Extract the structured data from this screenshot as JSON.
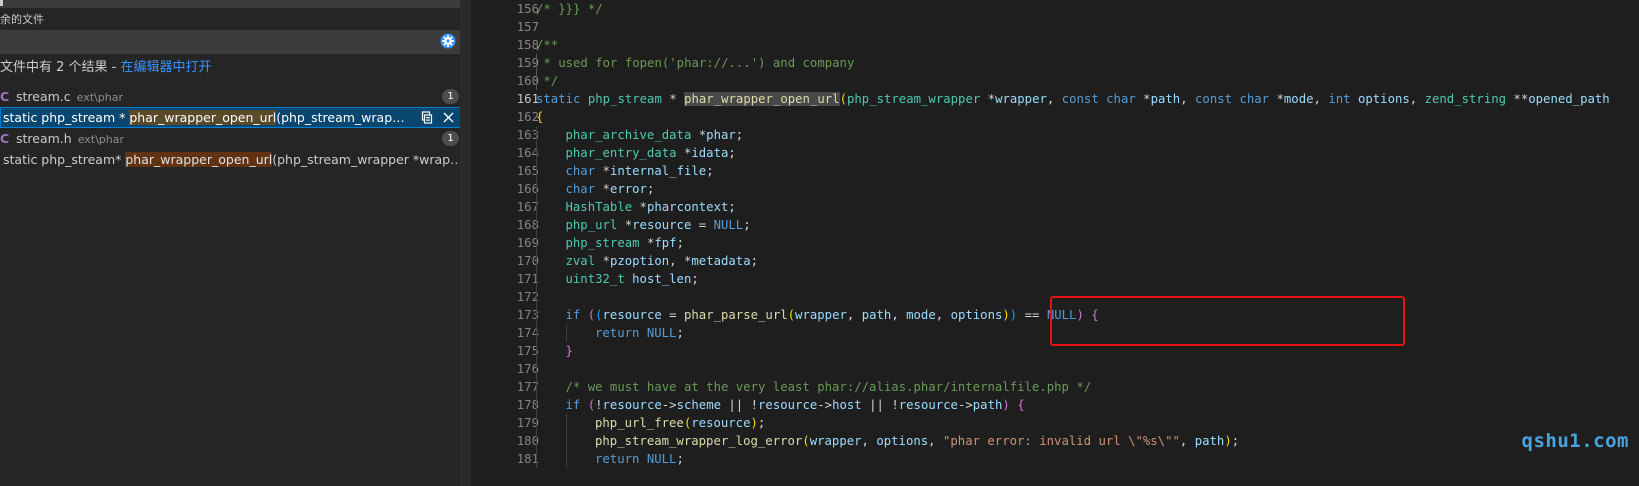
{
  "search_panel": {
    "files_label": "余的文件",
    "summary_text": "文件中有 2 个结果 - ",
    "open_in_editor_link": "在编辑器中打开",
    "results": [
      {
        "file": "stream.c",
        "dir": "ext\\phar",
        "count": "1",
        "match": {
          "before": "static php_stream * ",
          "highlight": "phar_wrapper_open_url",
          "after": "(php_stream_wrapper *wrapp..."
        }
      },
      {
        "file": "stream.h",
        "dir": "ext\\phar",
        "count": "1",
        "match": {
          "before": "static php_stream* ",
          "highlight": "phar_wrapper_open_url",
          "after": "(php_stream_wrapper *wrapper, const ch..."
        }
      }
    ]
  },
  "editor": {
    "current_line": "161",
    "lines": [
      {
        "n": "156",
        "indent": 0,
        "tokens": [
          {
            "c": "cm",
            "t": "/* }}} */"
          }
        ]
      },
      {
        "n": "157",
        "indent": 0,
        "tokens": []
      },
      {
        "n": "158",
        "indent": 0,
        "tokens": [
          {
            "c": "cm",
            "t": "/**"
          }
        ]
      },
      {
        "n": "159",
        "indent": 0,
        "tokens": [
          {
            "c": "cm",
            "t": " * used for fopen('phar://...') and company"
          }
        ]
      },
      {
        "n": "160",
        "indent": 0,
        "tokens": [
          {
            "c": "cm",
            "t": " */"
          }
        ]
      },
      {
        "n": "161",
        "indent": 0,
        "tokens": [
          {
            "c": "kw",
            "t": "static"
          },
          {
            "c": "pl",
            "t": " "
          },
          {
            "c": "ty",
            "t": "php_stream"
          },
          {
            "c": "pl",
            "t": " * "
          },
          {
            "c": "fn hlsym",
            "t": "phar_wrapper_open_url"
          },
          {
            "c": "br1",
            "t": "("
          },
          {
            "c": "ty",
            "t": "php_stream_wrapper"
          },
          {
            "c": "pl",
            "t": " *"
          },
          {
            "c": "va",
            "t": "wrapper"
          },
          {
            "c": "pl",
            "t": ", "
          },
          {
            "c": "kw",
            "t": "const"
          },
          {
            "c": "pl",
            "t": " "
          },
          {
            "c": "kw",
            "t": "char"
          },
          {
            "c": "pl",
            "t": " *"
          },
          {
            "c": "va",
            "t": "path"
          },
          {
            "c": "pl",
            "t": ", "
          },
          {
            "c": "kw",
            "t": "const"
          },
          {
            "c": "pl",
            "t": " "
          },
          {
            "c": "kw",
            "t": "char"
          },
          {
            "c": "pl",
            "t": " *"
          },
          {
            "c": "va",
            "t": "mode"
          },
          {
            "c": "pl",
            "t": ", "
          },
          {
            "c": "kw",
            "t": "int"
          },
          {
            "c": "pl",
            "t": " "
          },
          {
            "c": "va",
            "t": "options"
          },
          {
            "c": "pl",
            "t": ", "
          },
          {
            "c": "ty",
            "t": "zend_string"
          },
          {
            "c": "pl",
            "t": " **"
          },
          {
            "c": "va",
            "t": "opened_path"
          }
        ]
      },
      {
        "n": "162",
        "indent": 0,
        "tokens": [
          {
            "c": "br1",
            "t": "{"
          }
        ]
      },
      {
        "n": "163",
        "indent": 1,
        "tokens": [
          {
            "c": "ty",
            "t": "phar_archive_data"
          },
          {
            "c": "pl",
            "t": " *"
          },
          {
            "c": "va",
            "t": "phar"
          },
          {
            "c": "pl",
            "t": ";"
          }
        ]
      },
      {
        "n": "164",
        "indent": 1,
        "tokens": [
          {
            "c": "ty",
            "t": "phar_entry_data"
          },
          {
            "c": "pl",
            "t": " *"
          },
          {
            "c": "va",
            "t": "idata"
          },
          {
            "c": "pl",
            "t": ";"
          }
        ]
      },
      {
        "n": "165",
        "indent": 1,
        "tokens": [
          {
            "c": "kw",
            "t": "char"
          },
          {
            "c": "pl",
            "t": " *"
          },
          {
            "c": "va",
            "t": "internal_file"
          },
          {
            "c": "pl",
            "t": ";"
          }
        ]
      },
      {
        "n": "166",
        "indent": 1,
        "tokens": [
          {
            "c": "kw",
            "t": "char"
          },
          {
            "c": "pl",
            "t": " *"
          },
          {
            "c": "va",
            "t": "error"
          },
          {
            "c": "pl",
            "t": ";"
          }
        ]
      },
      {
        "n": "167",
        "indent": 1,
        "tokens": [
          {
            "c": "ty",
            "t": "HashTable"
          },
          {
            "c": "pl",
            "t": " *"
          },
          {
            "c": "va",
            "t": "pharcontext"
          },
          {
            "c": "pl",
            "t": ";"
          }
        ]
      },
      {
        "n": "168",
        "indent": 1,
        "tokens": [
          {
            "c": "ty",
            "t": "php_url"
          },
          {
            "c": "pl",
            "t": " *"
          },
          {
            "c": "va",
            "t": "resource"
          },
          {
            "c": "pl",
            "t": " = "
          },
          {
            "c": "kw",
            "t": "NULL"
          },
          {
            "c": "pl",
            "t": ";"
          }
        ]
      },
      {
        "n": "169",
        "indent": 1,
        "tokens": [
          {
            "c": "ty",
            "t": "php_stream"
          },
          {
            "c": "pl",
            "t": " *"
          },
          {
            "c": "va",
            "t": "fpf"
          },
          {
            "c": "pl",
            "t": ";"
          }
        ]
      },
      {
        "n": "170",
        "indent": 1,
        "tokens": [
          {
            "c": "ty",
            "t": "zval"
          },
          {
            "c": "pl",
            "t": " *"
          },
          {
            "c": "va",
            "t": "pzoption"
          },
          {
            "c": "pl",
            "t": ", *"
          },
          {
            "c": "va",
            "t": "metadata"
          },
          {
            "c": "pl",
            "t": ";"
          }
        ]
      },
      {
        "n": "171",
        "indent": 1,
        "tokens": [
          {
            "c": "ty",
            "t": "uint32_t"
          },
          {
            "c": "pl",
            "t": " "
          },
          {
            "c": "va",
            "t": "host_len"
          },
          {
            "c": "pl",
            "t": ";"
          }
        ]
      },
      {
        "n": "172",
        "indent": 1,
        "tokens": []
      },
      {
        "n": "173",
        "indent": 1,
        "tokens": [
          {
            "c": "kw",
            "t": "if"
          },
          {
            "c": "pl",
            "t": " "
          },
          {
            "c": "br2",
            "t": "("
          },
          {
            "c": "br3",
            "t": "("
          },
          {
            "c": "va",
            "t": "resource"
          },
          {
            "c": "pl",
            "t": " = "
          },
          {
            "c": "fn",
            "t": "phar_parse_url"
          },
          {
            "c": "br1",
            "t": "("
          },
          {
            "c": "va",
            "t": "wrapper"
          },
          {
            "c": "pl",
            "t": ", "
          },
          {
            "c": "va",
            "t": "path"
          },
          {
            "c": "pl",
            "t": ", "
          },
          {
            "c": "va",
            "t": "mode"
          },
          {
            "c": "pl",
            "t": ", "
          },
          {
            "c": "va",
            "t": "options"
          },
          {
            "c": "br1",
            "t": ")"
          },
          {
            "c": "br3",
            "t": ")"
          },
          {
            "c": "pl",
            "t": " == "
          },
          {
            "c": "kw",
            "t": "NULL"
          },
          {
            "c": "br2",
            "t": ")"
          },
          {
            "c": "pl",
            "t": " "
          },
          {
            "c": "br2",
            "t": "{"
          }
        ]
      },
      {
        "n": "174",
        "indent": 2,
        "tokens": [
          {
            "c": "kw",
            "t": "return"
          },
          {
            "c": "pl",
            "t": " "
          },
          {
            "c": "kw",
            "t": "NULL"
          },
          {
            "c": "pl",
            "t": ";"
          }
        ]
      },
      {
        "n": "175",
        "indent": 1,
        "tokens": [
          {
            "c": "br2",
            "t": "}"
          }
        ]
      },
      {
        "n": "176",
        "indent": 1,
        "tokens": []
      },
      {
        "n": "177",
        "indent": 1,
        "tokens": [
          {
            "c": "cm",
            "t": "/* we must have at the very least phar://alias.phar/internalfile.php */"
          }
        ]
      },
      {
        "n": "178",
        "indent": 1,
        "tokens": [
          {
            "c": "kw",
            "t": "if"
          },
          {
            "c": "pl",
            "t": " "
          },
          {
            "c": "br2",
            "t": "("
          },
          {
            "c": "pl",
            "t": "!"
          },
          {
            "c": "va",
            "t": "resource"
          },
          {
            "c": "pl",
            "t": "->"
          },
          {
            "c": "va",
            "t": "scheme"
          },
          {
            "c": "pl",
            "t": " || !"
          },
          {
            "c": "va",
            "t": "resource"
          },
          {
            "c": "pl",
            "t": "->"
          },
          {
            "c": "va",
            "t": "host"
          },
          {
            "c": "pl",
            "t": " || !"
          },
          {
            "c": "va",
            "t": "resource"
          },
          {
            "c": "pl",
            "t": "->"
          },
          {
            "c": "va",
            "t": "path"
          },
          {
            "c": "br2",
            "t": ")"
          },
          {
            "c": "pl",
            "t": " "
          },
          {
            "c": "br2",
            "t": "{"
          }
        ]
      },
      {
        "n": "179",
        "indent": 2,
        "tokens": [
          {
            "c": "fn",
            "t": "php_url_free"
          },
          {
            "c": "br1",
            "t": "("
          },
          {
            "c": "va",
            "t": "resource"
          },
          {
            "c": "br1",
            "t": ")"
          },
          {
            "c": "pl",
            "t": ";"
          }
        ]
      },
      {
        "n": "180",
        "indent": 2,
        "tokens": [
          {
            "c": "fn",
            "t": "php_stream_wrapper_log_error"
          },
          {
            "c": "br1",
            "t": "("
          },
          {
            "c": "va",
            "t": "wrapper"
          },
          {
            "c": "pl",
            "t": ", "
          },
          {
            "c": "va",
            "t": "options"
          },
          {
            "c": "pl",
            "t": ", "
          },
          {
            "c": "st",
            "t": "\"phar error: invalid url \\\"%s\\\"\""
          },
          {
            "c": "pl",
            "t": ", "
          },
          {
            "c": "va",
            "t": "path"
          },
          {
            "c": "br1",
            "t": ")"
          },
          {
            "c": "pl",
            "t": ";"
          }
        ]
      },
      {
        "n": "181",
        "indent": 2,
        "tokens": [
          {
            "c": "kw",
            "t": "return"
          },
          {
            "c": "pl",
            "t": " "
          },
          {
            "c": "kw",
            "t": "NULL"
          },
          {
            "c": "pl",
            "t": ";"
          }
        ]
      }
    ]
  },
  "watermark": "qshu1.com",
  "colors": {
    "editor_bg": "#1e1e1e",
    "sidebar_bg": "#252526",
    "selection_bg": "#094771",
    "annotation_box": "#e51414",
    "link": "#3794ff",
    "watermark": "#4aa3df"
  },
  "icons": {
    "exclude_settings": "gear-icon",
    "c_file": "c-language-icon",
    "replace": "replace-icon",
    "dismiss": "close-icon"
  }
}
